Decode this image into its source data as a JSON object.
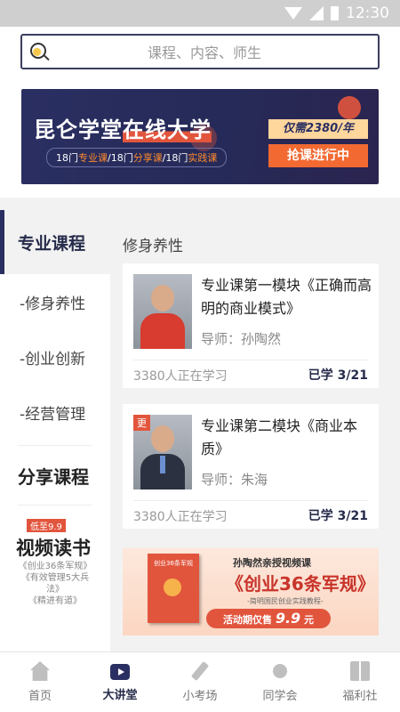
{
  "status_bar": {
    "time": "12:30"
  },
  "search": {
    "placeholder": "课程、内容、师生"
  },
  "banner": {
    "title_part1": "昆仑学堂",
    "title_part2": "在线大学",
    "sub_1": "18门",
    "sub_2": "专业课",
    "sub_3": "/18门",
    "sub_4": "分享课",
    "sub_5": "/18门",
    "sub_6": "实践课",
    "price": "仅需2380/年",
    "cta": "抢课进行中"
  },
  "sidebar": {
    "active": "专业课程",
    "items": [
      "-修身养性",
      "-创业创新",
      "-经营管理"
    ],
    "share_heading": "分享课程",
    "promo_badge": "低至9.9",
    "promo_title": "视频读书",
    "promo_books": [
      "《创业36条军规》",
      "《有效管理5大兵法》",
      "《精进有道》"
    ]
  },
  "content": {
    "section_title": "修身养性",
    "courses": [
      {
        "title": "专业课第一模块《正确而高明的商业模式》",
        "teacher": "导师：孙陶然",
        "learners": "3380人正在学习",
        "progress": "已学  3/21",
        "tag": ""
      },
      {
        "title": "专业课第二模块《商业本质》",
        "teacher": "导师：朱海",
        "learners": "3380人正在学习",
        "progress": "已学  3/21",
        "tag": "更"
      }
    ],
    "ad": {
      "line1": "孙陶然亲授视频课",
      "line2": "《创业36条军规》",
      "line3": "-简明国民创业实践教程-",
      "book_title": "创业36条军规",
      "btn_prefix": "活动期仅售",
      "btn_price": "9.9",
      "btn_suffix": "元"
    }
  },
  "tabbar": {
    "tabs": [
      {
        "label": "首页",
        "icon": "home-icon"
      },
      {
        "label": "大讲堂",
        "icon": "video-icon"
      },
      {
        "label": "小考场",
        "icon": "pen-icon"
      },
      {
        "label": "同学会",
        "icon": "user-icon"
      },
      {
        "label": "福利社",
        "icon": "gift-icon"
      }
    ],
    "active_index": 1
  }
}
